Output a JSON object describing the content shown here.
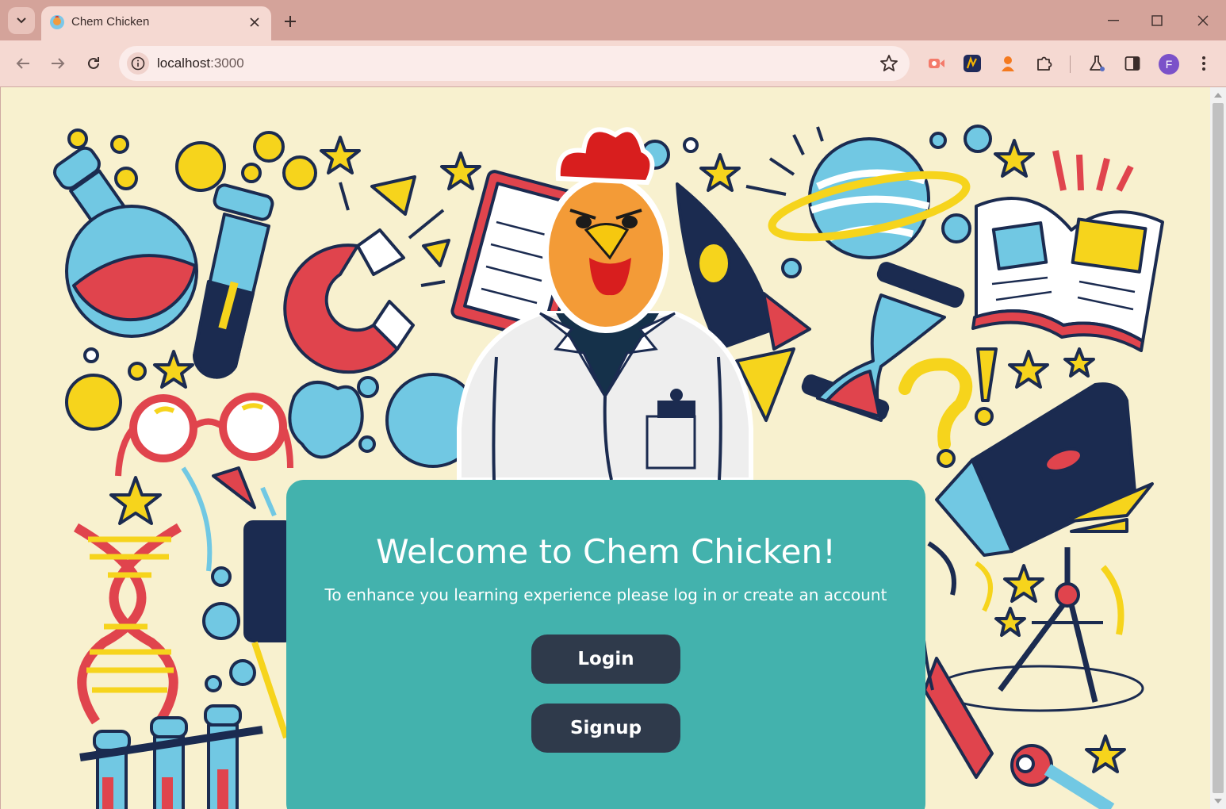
{
  "browser": {
    "tab_title": "Chem Chicken",
    "url_host": "localhost",
    "url_port": ":3000",
    "profile_initial": "F"
  },
  "page": {
    "title": "Welcome to Chem Chicken!",
    "subtitle": "To enhance you learning experience please log in or create an account",
    "login_label": "Login",
    "signup_label": "Signup"
  },
  "colors": {
    "background": "#f8f1cf",
    "card": "#43b2ad",
    "button": "#2f3a4b",
    "chrome_tabbar": "#d4a39a",
    "chrome_toolbar": "#f5d9d2"
  },
  "icons": [
    "tab-search-icon",
    "chicken-favicon",
    "close-icon",
    "plus-icon",
    "minimize-icon",
    "maximize-icon",
    "window-close-icon",
    "back-arrow-icon",
    "forward-arrow-icon",
    "reload-icon",
    "info-icon",
    "bookmark-star-icon",
    "extension-icons",
    "puzzle-icon",
    "labs-flask-icon",
    "side-panel-icon",
    "more-menu-icon"
  ]
}
